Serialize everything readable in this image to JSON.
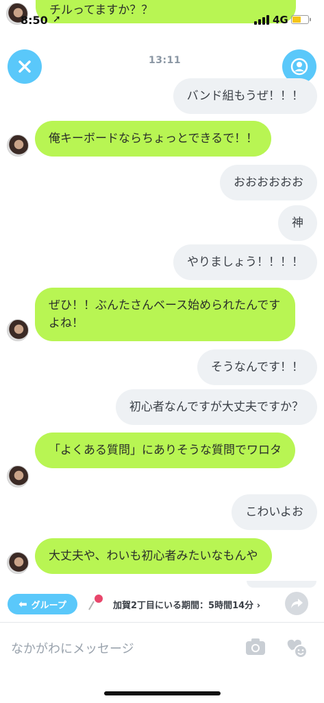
{
  "status_bar": {
    "time": "8:50",
    "network": "4G"
  },
  "top_preview": {
    "text": "チルってますか？？"
  },
  "header": {
    "timestamp": "13:11"
  },
  "messages": [
    {
      "side": "out",
      "text": "バンド組もうぜ！！！"
    },
    {
      "side": "in",
      "text": "俺キーボードならちょっとできるで！！"
    },
    {
      "side": "out",
      "text": "おおおおおお"
    },
    {
      "side": "out",
      "text": "神"
    },
    {
      "side": "out",
      "text": "やりましょう！！！！"
    },
    {
      "side": "in",
      "text": "ぜひ！！ぶんたさんベース始められたんですよね！"
    },
    {
      "side": "out",
      "text": "そうなんです！！"
    },
    {
      "side": "out",
      "text": "初心者なんですが大丈夫ですか？"
    },
    {
      "side": "in",
      "text": "「よくある質問」にありそうな質問でワロタ"
    },
    {
      "side": "out",
      "text": "こわいよお"
    },
    {
      "side": "in",
      "text": "大丈夫や、わいも初心者みたいなもんや"
    }
  ],
  "bottom_bar": {
    "group_button": "グループ",
    "location_info": "加賀2丁目にいる期間：5時間14分 ›"
  },
  "composer": {
    "placeholder": "なかがわにメッセージ"
  },
  "colors": {
    "accent": "#5ac8fa",
    "incoming": "#b8f553",
    "outgoing": "#eef1f4"
  }
}
